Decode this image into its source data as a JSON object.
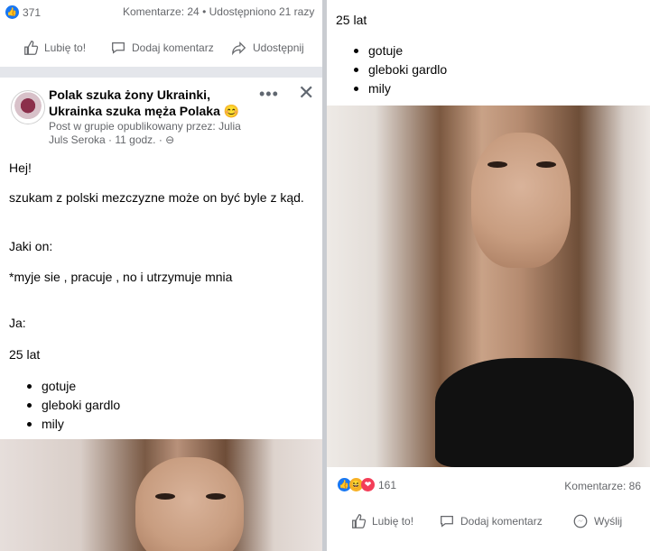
{
  "left_post_top": {
    "reaction_count": "371",
    "comments": "Komentarze: 24",
    "separator": "•",
    "shares": "Udostępniono 21 razy"
  },
  "left_actions": {
    "like": "Lubię to!",
    "comment": "Dodaj komentarz",
    "share": "Udostępnij"
  },
  "post": {
    "group_title": "Polak szuka  żony Ukrainki, Ukrainka szuka męża Polaka",
    "emoji": "😊",
    "subtitle": "Post w grupie opublikowany przez: Julia Juls Seroka · 11 godz. · ⊖",
    "greeting": "Hej!",
    "line1": "szukam z polski mezczyzne może on być byle z kąd.",
    "line2": "Jaki on:",
    "line3": "*myje sie , pracuje , no i utrzymuje mnia",
    "line4": "Ja:",
    "age": "25 lat",
    "traits": [
      "gotuje",
      "gleboki gardlo",
      "mily"
    ]
  },
  "right_post": {
    "age": "25 lat",
    "traits": [
      "gotuje",
      "gleboki gardlo",
      "mily"
    ],
    "reaction_count": "161",
    "comments": "Komentarze: 86"
  },
  "right_actions": {
    "like": "Lubię to!",
    "comment": "Dodaj komentarz",
    "send": "Wyślij"
  },
  "colors": {
    "facebook_blue": "#1877f2",
    "text_secondary": "#65676b",
    "divider": "#c9ccd1"
  },
  "icons": [
    "like-icon",
    "haha-icon",
    "love-icon",
    "thumbs-up-icon",
    "comment-icon",
    "share-icon",
    "messenger-icon",
    "more-icon",
    "close-icon"
  ]
}
